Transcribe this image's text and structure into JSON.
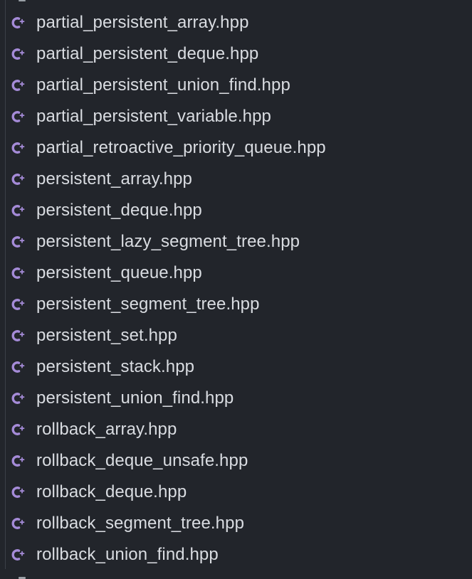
{
  "theme": {
    "background": "#22252b",
    "text": "#d9dce1",
    "icon_color": "#a58bd8"
  },
  "explorer": {
    "file_icon": "cpp-plus-icon",
    "files": [
      {
        "label": "partial_persistent_array.hpp"
      },
      {
        "label": "partial_persistent_deque.hpp"
      },
      {
        "label": "partial_persistent_union_find.hpp"
      },
      {
        "label": "partial_persistent_variable.hpp"
      },
      {
        "label": "partial_retroactive_priority_queue.hpp"
      },
      {
        "label": "persistent_array.hpp"
      },
      {
        "label": "persistent_deque.hpp"
      },
      {
        "label": "persistent_lazy_segment_tree.hpp"
      },
      {
        "label": "persistent_queue.hpp"
      },
      {
        "label": "persistent_segment_tree.hpp"
      },
      {
        "label": "persistent_set.hpp"
      },
      {
        "label": "persistent_stack.hpp"
      },
      {
        "label": "persistent_union_find.hpp"
      },
      {
        "label": "rollback_array.hpp"
      },
      {
        "label": "rollback_deque_unsafe.hpp"
      },
      {
        "label": "rollback_deque.hpp"
      },
      {
        "label": "rollback_segment_tree.hpp"
      },
      {
        "label": "rollback_union_find.hpp"
      }
    ]
  }
}
